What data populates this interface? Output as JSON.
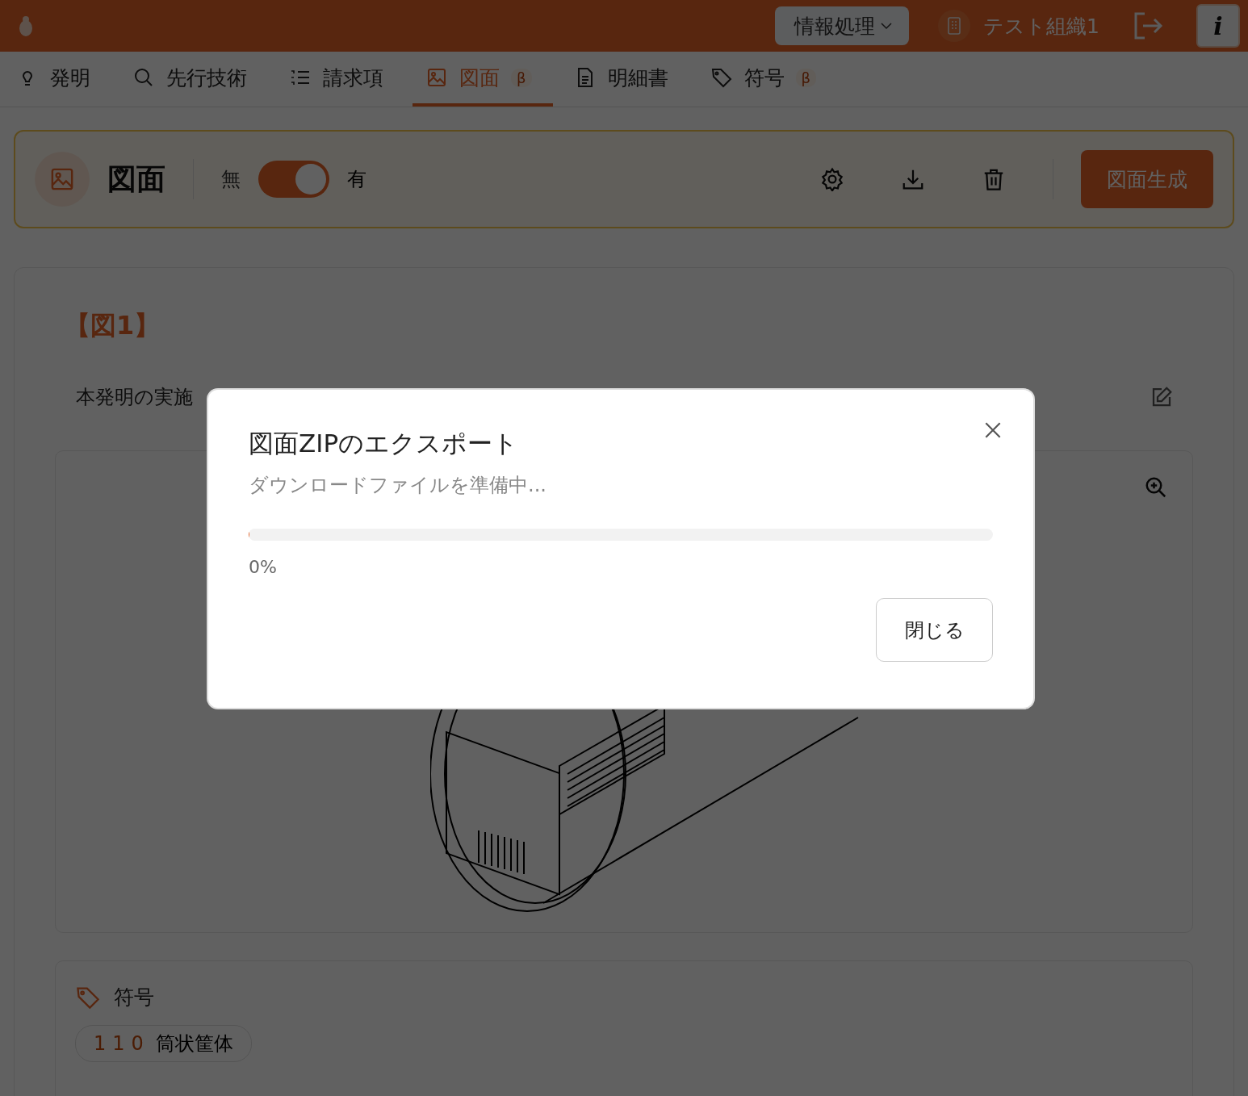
{
  "header": {
    "workspace": "情報処理",
    "organization": "テスト組織1",
    "info_button": "i"
  },
  "tabs": [
    {
      "label": "発明",
      "selected": false
    },
    {
      "label": "先行技術",
      "selected": false
    },
    {
      "label": "請求項",
      "selected": false
    },
    {
      "label": "図面",
      "selected": true,
      "badge": "β"
    },
    {
      "label": "明細書",
      "selected": false
    },
    {
      "label": "符号",
      "selected": false,
      "badge": "β"
    }
  ],
  "toolbar": {
    "title": "図面",
    "toggle": {
      "off_label": "無",
      "on_label": "有",
      "on": true
    },
    "generate_button": "図面生成"
  },
  "figure": {
    "heading": "【図1】",
    "caption": "本発明の実施"
  },
  "reference_signs": {
    "title": "符号",
    "items": [
      {
        "number": "110",
        "name": "筒状筐体"
      }
    ]
  },
  "dialog": {
    "title": "図面ZIPのエクスポート",
    "message": "ダウンロードファイルを準備中...",
    "level": 0,
    "percent": "0%",
    "close_button": "閉じる"
  }
}
